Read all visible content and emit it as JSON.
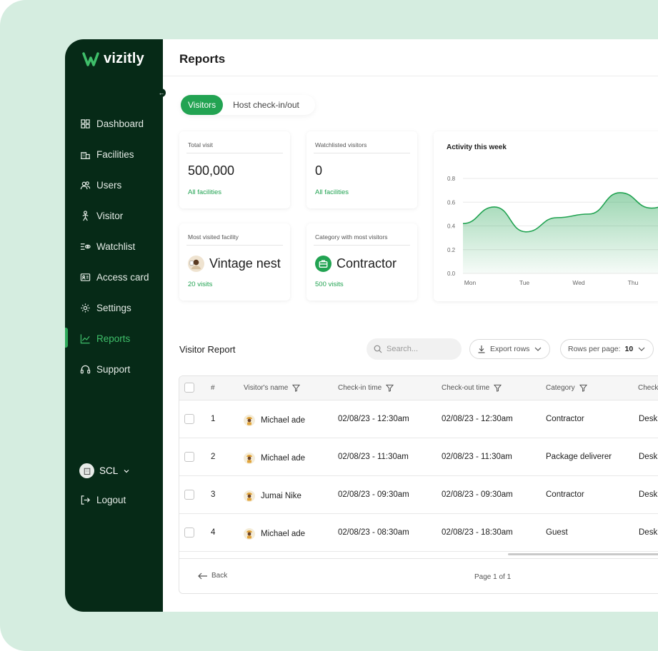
{
  "app": {
    "brand": "vizitly",
    "brand_color": "#22a352",
    "sidebar_color": "#062a17"
  },
  "sidebar": {
    "items": [
      {
        "label": "Dashboard",
        "icon": "grid-icon"
      },
      {
        "label": "Facilities",
        "icon": "building-icon"
      },
      {
        "label": "Users",
        "icon": "users-icon"
      },
      {
        "label": "Visitor",
        "icon": "person-icon"
      },
      {
        "label": "Watchlist",
        "icon": "watchlist-icon"
      },
      {
        "label": "Access card",
        "icon": "id-card-icon"
      },
      {
        "label": "Settings",
        "icon": "gear-icon"
      },
      {
        "label": "Reports",
        "icon": "trend-icon",
        "active": true
      },
      {
        "label": "Support",
        "icon": "headset-icon"
      }
    ],
    "org": "SCL",
    "logout": "Logout"
  },
  "header": {
    "title": "Reports"
  },
  "tabs": [
    {
      "label": "Visitors",
      "active": true
    },
    {
      "label": "Host check-in/out",
      "active": false
    }
  ],
  "cards": [
    {
      "label": "Total visit",
      "value": "500,000",
      "link": "All facilities"
    },
    {
      "label": "Watchlisted visitors",
      "value": "0",
      "link": "All facilities"
    },
    {
      "label": "Most visited facility",
      "value": "Vintage nest",
      "link": "20 visits"
    },
    {
      "label": "Category with most visitors",
      "value": "Contractor",
      "link": "500 visits"
    }
  ],
  "chart_data": {
    "type": "area",
    "title": "Activity this week",
    "x": [
      "Mon",
      "Tue",
      "Wed",
      "Thu"
    ],
    "ylim": [
      0,
      0.8
    ],
    "yticks": [
      "0.8",
      "0.6",
      "0.4",
      "0.2",
      "0.0"
    ],
    "series": [
      {
        "values": [
          0.42,
          0.56,
          0.35,
          0.47,
          0.5,
          0.68,
          0.55,
          0.65
        ]
      }
    ],
    "grid": true,
    "color": "#22a352"
  },
  "report": {
    "title": "Visitor Report",
    "search_placeholder": "Search...",
    "export_label": "Export rows",
    "rows_per_page_label": "Rows per page:",
    "rows_per_page_value": "10",
    "columns": [
      "#",
      "Visitor's name",
      "Check-in time",
      "Check-out time",
      "Category",
      "Check"
    ],
    "rows": [
      {
        "n": "1",
        "name": "Michael ade",
        "in": "02/08/23 - 12:30am",
        "out": "02/08/23 - 12:30am",
        "category": "Contractor",
        "check": "Desk"
      },
      {
        "n": "2",
        "name": "Michael ade",
        "in": "02/08/23 - 11:30am",
        "out": "02/08/23 - 11:30am",
        "category": "Package deliverer",
        "check": "Desk"
      },
      {
        "n": "3",
        "name": "Jumai Nike",
        "in": "02/08/23 - 09:30am",
        "out": "02/08/23 - 09:30am",
        "category": "Contractor",
        "check": "Desk"
      },
      {
        "n": "4",
        "name": "Michael ade",
        "in": "02/08/23 - 08:30am",
        "out": "02/08/23 - 18:30am",
        "category": "Guest",
        "check": "Desk"
      }
    ],
    "back_label": "Back",
    "pager_text": "Page 1 of 1"
  }
}
